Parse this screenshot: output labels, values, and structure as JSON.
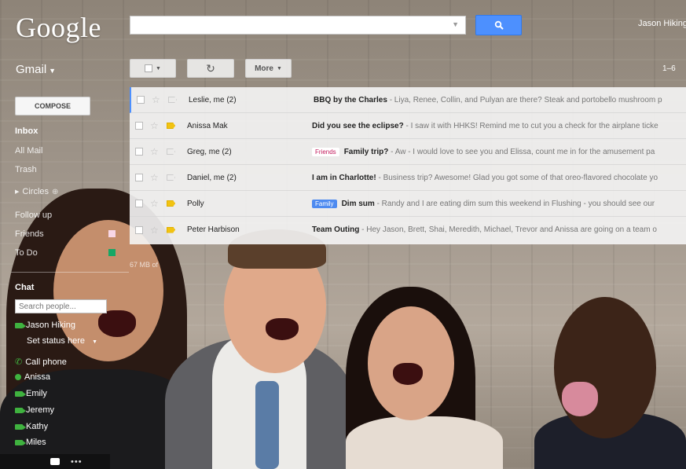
{
  "header": {
    "logo": "Google",
    "search": {
      "value": "",
      "placeholder": ""
    },
    "user_name": "Jason Hiking"
  },
  "app_label": "Gmail",
  "toolbar": {
    "more_label": "More",
    "page_range": "1–6"
  },
  "sidebar": {
    "compose_label": "COMPOSE",
    "items": [
      {
        "label": "Inbox",
        "bold": true
      },
      {
        "label": "All Mail"
      },
      {
        "label": "Trash"
      },
      {
        "label": "Circles"
      },
      {
        "label": "Follow up"
      },
      {
        "label": "Friends"
      },
      {
        "label": "To Do"
      }
    ],
    "storage": "67 MB of"
  },
  "chat": {
    "title": "Chat",
    "search_placeholder": "Search people...",
    "self_name": "Jason Hiking",
    "set_status": "Set status here",
    "contacts": [
      {
        "name": "Call phone",
        "kind": "phone"
      },
      {
        "name": "Anissa",
        "kind": "dot"
      },
      {
        "name": "Emily",
        "kind": "cam"
      },
      {
        "name": "Jeremy",
        "kind": "cam"
      },
      {
        "name": "Kathy",
        "kind": "cam"
      },
      {
        "name": "Miles",
        "kind": "cam"
      }
    ]
  },
  "messages": [
    {
      "sender": "Leslie, me (2)",
      "important": false,
      "label": "",
      "subject": "BBQ by the Charles",
      "snippet": " - Liya, Renee, Collin, and Pulyan are there? Steak and portobello mushroom p"
    },
    {
      "sender": "Anissa Mak",
      "important": true,
      "label": "",
      "subject": "Did you see the eclipse?",
      "snippet": " - I saw it with HHKS! Remind me to cut you a check for the airplane ticke"
    },
    {
      "sender": "Greg, me (2)",
      "important": false,
      "label": "Friends",
      "subject": "Family trip?",
      "snippet": " - Aw - I would love to see you and Elissa, count me in for the amusement pa"
    },
    {
      "sender": "Daniel, me (2)",
      "important": false,
      "label": "",
      "subject": "I am in Charlotte!",
      "snippet": " - Business trip? Awesome! Glad you got some of that oreo-flavored chocolate yo"
    },
    {
      "sender": "Polly",
      "important": true,
      "label": "Family",
      "subject": "Dim sum",
      "snippet": " - Randy and I are eating dim sum this weekend in Flushing - you should see our"
    },
    {
      "sender": "Peter Harbison",
      "important": true,
      "label": "",
      "subject": "Team Outing",
      "snippet": " - Hey Jason, Brett, Shai, Meredith, Michael, Trevor and Anissa are going on a team o"
    }
  ],
  "colors": {
    "accent_blue": "#4d90fe",
    "important_yellow": "#f2c311",
    "friends_label": "#c2185b",
    "family_label": "#4d8af0",
    "chat_green": "#3fb23f"
  }
}
